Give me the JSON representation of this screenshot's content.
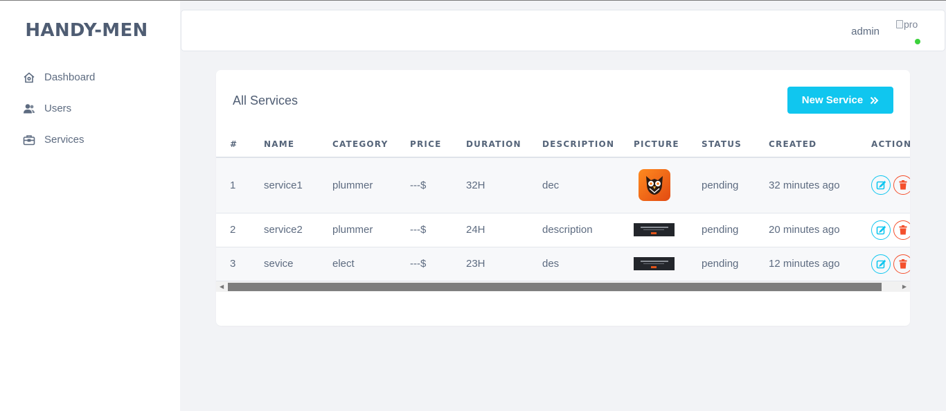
{
  "brand": "HANDY-MEN",
  "sidebar": {
    "items": [
      {
        "label": "Dashboard",
        "icon": "home-icon"
      },
      {
        "label": "Users",
        "icon": "users-icon"
      },
      {
        "label": "Services",
        "icon": "briefcase-icon"
      }
    ]
  },
  "header": {
    "username": "admin",
    "avatar_alt": "pro",
    "online_color": "#3cd23c"
  },
  "card": {
    "title": "All Services",
    "new_button_label": "New Service"
  },
  "table": {
    "columns": [
      "#",
      "NAME",
      "CATEGORY",
      "PRICE",
      "DURATION",
      "DESCRIPTION",
      "PICTURE",
      "STATUS",
      "CREATED",
      "ACTIONS"
    ],
    "rows": [
      {
        "num": "1",
        "name": "service1",
        "category": "plummer",
        "price": "---$",
        "duration": "32H",
        "description": "dec",
        "picture": "owl-logo",
        "status": "pending",
        "created": "32 minutes ago"
      },
      {
        "num": "2",
        "name": "service2",
        "category": "plummer",
        "price": "---$",
        "duration": "24H",
        "description": "description",
        "picture": "banner",
        "status": "pending",
        "created": "20 minutes ago"
      },
      {
        "num": "3",
        "name": "sevice",
        "category": "elect",
        "price": "---$",
        "duration": "23H",
        "description": "des",
        "picture": "banner",
        "status": "pending",
        "created": "12 minutes ago"
      }
    ]
  },
  "colors": {
    "accent": "#10c6ef",
    "danger": "#f4502d",
    "brand_text": "#4f5d73"
  }
}
